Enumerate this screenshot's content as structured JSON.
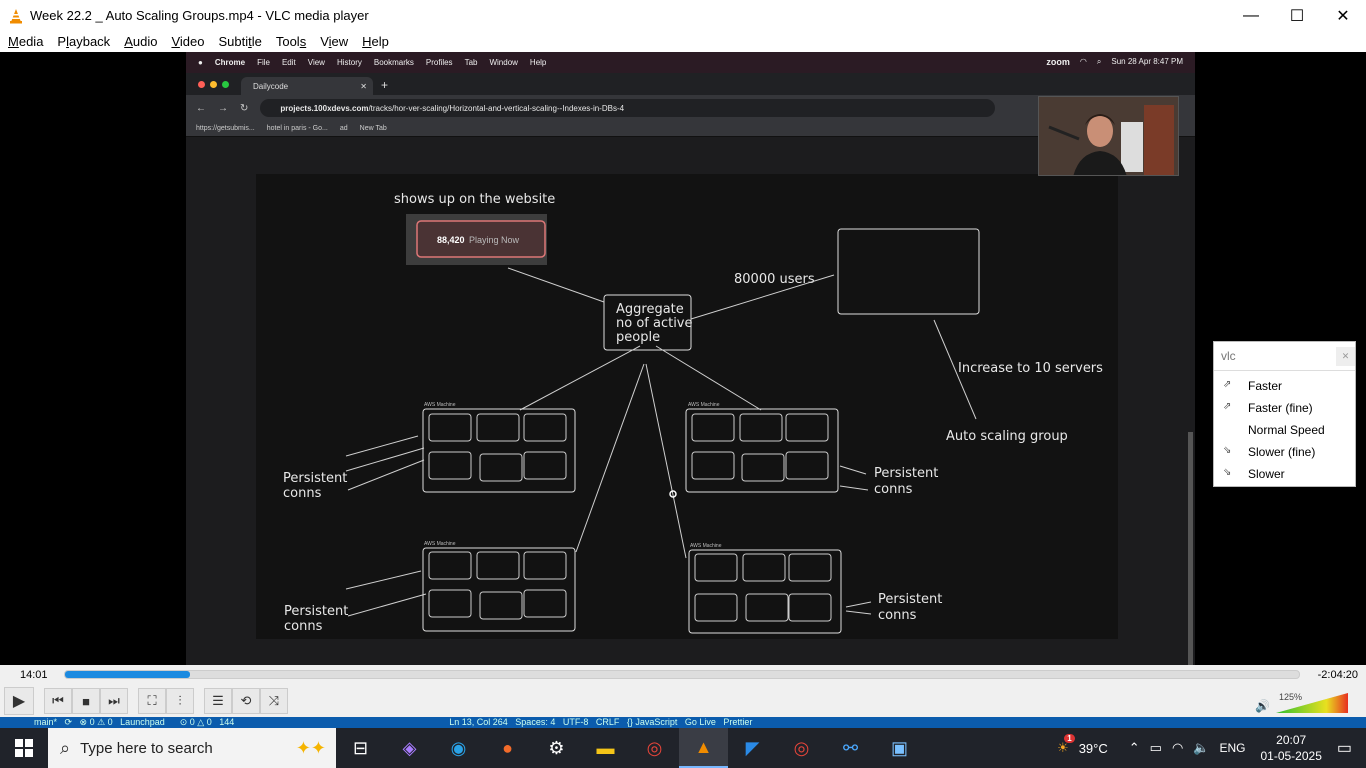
{
  "window": {
    "title": "Week 22.2 _ Auto Scaling Groups.mp4 - VLC media player",
    "minimize": "—",
    "maximize": "☐",
    "close": "✕"
  },
  "menu": [
    {
      "pre": "",
      "u": "M",
      "post": "edia"
    },
    {
      "pre": "P",
      "u": "l",
      "post": "ayback"
    },
    {
      "pre": "",
      "u": "A",
      "post": "udio"
    },
    {
      "pre": "",
      "u": "V",
      "post": "ideo"
    },
    {
      "pre": "Subti",
      "u": "t",
      "post": "le"
    },
    {
      "pre": "Tool",
      "u": "s",
      "post": ""
    },
    {
      "pre": "V",
      "u": "i",
      "post": "ew"
    },
    {
      "pre": "",
      "u": "H",
      "post": "elp"
    }
  ],
  "mac": {
    "app": "Chrome",
    "menus": [
      "File",
      "Edit",
      "View",
      "History",
      "Bookmarks",
      "Profiles",
      "Tab",
      "Window",
      "Help"
    ],
    "zoom": "zoom",
    "datetime": "Sun 28 Apr  8:47 PM"
  },
  "browser": {
    "tab": "Dailycode",
    "url_domain": "projects.100xdevs.com",
    "url_path": "/tracks/hor-ver-scaling/Horizontal-and-vertical-scaling--Indexes-in-DBs-4",
    "bookmarks": [
      "https://getsubmis...",
      "hotel in paris - Go...",
      "ad",
      "New Tab"
    ]
  },
  "diagram": {
    "shows_up": "shows up on the website",
    "counter_num": "88,420",
    "counter_text": "Playing Now",
    "aggregate_1": "Aggregate",
    "aggregate_2": "no of active",
    "aggregate_3": "people",
    "users": "80000 users",
    "increase": "Increase to 10 servers",
    "asg": "Auto scaling group",
    "aws": "AWS Machine",
    "persistent": "Persistent",
    "conns": "conns"
  },
  "popup": {
    "search": "vlc",
    "clear": "✕",
    "items": [
      "Faster",
      "Faster (fine)",
      "Normal Speed",
      "Slower (fine)",
      "Slower"
    ]
  },
  "player": {
    "elapsed": "14:01",
    "remaining": "-2:04:20",
    "progress": 0.101,
    "volume_pct": "125%"
  },
  "status": {
    "text": "main*   ⟳   ⊗ 0 ⚠ 0   Launchpad      ⊙ 0 △ 0   144                                                                                      Ln 13, Col 264   Spaces: 4   UTF-8   CRLF   {} JavaScript   Go Live   Prettier"
  },
  "taskbar": {
    "search_placeholder": "Type here to search",
    "temp": "39°C",
    "lang": "ENG",
    "time": "20:07",
    "date": "01-05-2025",
    "badge": "1"
  }
}
